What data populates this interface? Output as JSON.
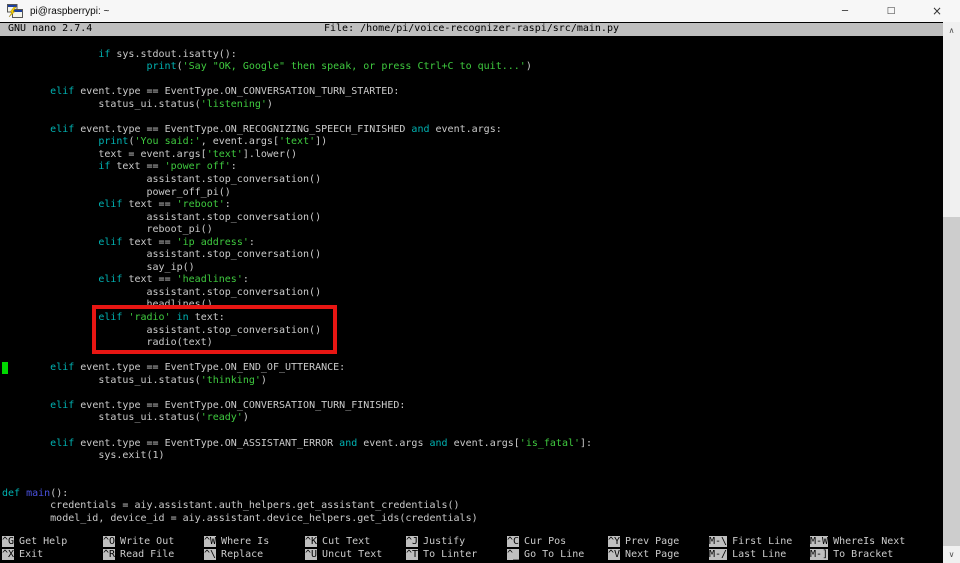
{
  "window": {
    "title": "pi@raspberrypi: ~",
    "controls": {
      "minimize": "─",
      "maximize": "□",
      "close": "×"
    }
  },
  "colors": {
    "c-plain": "#cbcbcb",
    "c-keyword": "#00b2b2",
    "c-string": "#3fca3f",
    "c-func": "#4a52e0",
    "c-cursor": "#00d900",
    "c-red": "#e81613",
    "c-bar": "#bfbfbf"
  },
  "nano": {
    "version": "GNU nano 2.7.4",
    "file": "File: /home/pi/voice-recognizer-raspi/src/main.py"
  },
  "editor": {
    "cursor": {
      "line": 26,
      "col": 0
    },
    "highlight": {
      "from_line": 22,
      "to_line": 24
    },
    "lines": [
      [],
      [
        [
          "p",
          "                "
        ],
        [
          "k",
          "if"
        ],
        [
          "p",
          " sys.stdout.isatty():"
        ]
      ],
      [
        [
          "p",
          "                        "
        ],
        [
          "k",
          "print"
        ],
        [
          "p",
          "("
        ],
        [
          "s",
          "'Say \"OK, Google\" then speak, or press Ctrl+C to quit...'"
        ],
        [
          "p",
          ")"
        ]
      ],
      [],
      [
        [
          "p",
          "        "
        ],
        [
          "k",
          "elif"
        ],
        [
          "p",
          " event.type == EventType.ON_CONVERSATION_TURN_STARTED:"
        ]
      ],
      [
        [
          "p",
          "                status_ui.status("
        ],
        [
          "s",
          "'listening'"
        ],
        [
          "p",
          ")"
        ]
      ],
      [],
      [
        [
          "p",
          "        "
        ],
        [
          "k",
          "elif"
        ],
        [
          "p",
          " event.type == EventType.ON_RECOGNIZING_SPEECH_FINISHED "
        ],
        [
          "k",
          "and"
        ],
        [
          "p",
          " event.args:"
        ]
      ],
      [
        [
          "p",
          "                "
        ],
        [
          "k",
          "print"
        ],
        [
          "p",
          "("
        ],
        [
          "s",
          "'You said:'"
        ],
        [
          "p",
          ", event.args["
        ],
        [
          "s",
          "'text'"
        ],
        [
          "p",
          "])"
        ]
      ],
      [
        [
          "p",
          "                text = event.args["
        ],
        [
          "s",
          "'text'"
        ],
        [
          "p",
          "].lower()"
        ]
      ],
      [
        [
          "p",
          "                "
        ],
        [
          "k",
          "if"
        ],
        [
          "p",
          " text == "
        ],
        [
          "s",
          "'power off'"
        ],
        [
          "p",
          ":"
        ]
      ],
      [
        [
          "p",
          "                        assistant.stop_conversation()"
        ]
      ],
      [
        [
          "p",
          "                        power_off_pi()"
        ]
      ],
      [
        [
          "p",
          "                "
        ],
        [
          "k",
          "elif"
        ],
        [
          "p",
          " text == "
        ],
        [
          "s",
          "'reboot'"
        ],
        [
          "p",
          ":"
        ]
      ],
      [
        [
          "p",
          "                        assistant.stop_conversation()"
        ]
      ],
      [
        [
          "p",
          "                        reboot_pi()"
        ]
      ],
      [
        [
          "p",
          "                "
        ],
        [
          "k",
          "elif"
        ],
        [
          "p",
          " text == "
        ],
        [
          "s",
          "'ip address'"
        ],
        [
          "p",
          ":"
        ]
      ],
      [
        [
          "p",
          "                        assistant.stop_conversation()"
        ]
      ],
      [
        [
          "p",
          "                        say_ip()"
        ]
      ],
      [
        [
          "p",
          "                "
        ],
        [
          "k",
          "elif"
        ],
        [
          "p",
          " text == "
        ],
        [
          "s",
          "'headlines'"
        ],
        [
          "p",
          ":"
        ]
      ],
      [
        [
          "p",
          "                        assistant.stop_conversation()"
        ]
      ],
      [
        [
          "p",
          "                        headlines()"
        ]
      ],
      [
        [
          "p",
          "                "
        ],
        [
          "k",
          "elif"
        ],
        [
          "p",
          " "
        ],
        [
          "s",
          "'radio'"
        ],
        [
          "p",
          " "
        ],
        [
          "k",
          "in"
        ],
        [
          "p",
          " text:"
        ]
      ],
      [
        [
          "p",
          "                        assistant.stop_conversation()"
        ]
      ],
      [
        [
          "p",
          "                        radio(text)"
        ]
      ],
      [],
      [
        [
          "p",
          "        "
        ],
        [
          "k",
          "elif"
        ],
        [
          "p",
          " event.type == EventType.ON_END_OF_UTTERANCE:"
        ]
      ],
      [
        [
          "p",
          "                status_ui.status("
        ],
        [
          "s",
          "'thinking'"
        ],
        [
          "p",
          ")"
        ]
      ],
      [],
      [
        [
          "p",
          "        "
        ],
        [
          "k",
          "elif"
        ],
        [
          "p",
          " event.type == EventType.ON_CONVERSATION_TURN_FINISHED:"
        ]
      ],
      [
        [
          "p",
          "                status_ui.status("
        ],
        [
          "s",
          "'ready'"
        ],
        [
          "p",
          ")"
        ]
      ],
      [],
      [
        [
          "p",
          "        "
        ],
        [
          "k",
          "elif"
        ],
        [
          "p",
          " event.type == EventType.ON_ASSISTANT_ERROR "
        ],
        [
          "k",
          "and"
        ],
        [
          "p",
          " event.args "
        ],
        [
          "k",
          "and"
        ],
        [
          "p",
          " event.args["
        ],
        [
          "s",
          "'is_fatal'"
        ],
        [
          "p",
          "]:"
        ]
      ],
      [
        [
          "p",
          "                sys.exit(1)"
        ]
      ],
      [],
      [],
      [
        [
          "k",
          "def"
        ],
        [
          "p",
          " "
        ],
        [
          "f",
          "main"
        ],
        [
          "p",
          "():"
        ]
      ],
      [
        [
          "p",
          "        credentials = aiy.assistant.auth_helpers.get_assistant_credentials()"
        ]
      ],
      [
        [
          "p",
          "        model_id, device_id = aiy.assistant.device_helpers.get_ids(credentials)"
        ]
      ]
    ]
  },
  "footer": {
    "rows": [
      [
        {
          "key": "^G",
          "label": "Get Help"
        },
        {
          "key": "^O",
          "label": "Write Out"
        },
        {
          "key": "^W",
          "label": "Where Is"
        },
        {
          "key": "^K",
          "label": "Cut Text"
        },
        {
          "key": "^J",
          "label": "Justify"
        },
        {
          "key": "^C",
          "label": "Cur Pos"
        },
        {
          "key": "^Y",
          "label": "Prev Page"
        },
        {
          "key": "M-\\",
          "label": "First Line"
        },
        {
          "key": "M-W",
          "label": "WhereIs Next"
        }
      ],
      [
        {
          "key": "^X",
          "label": "Exit"
        },
        {
          "key": "^R",
          "label": "Read File"
        },
        {
          "key": "^\\",
          "label": "Replace"
        },
        {
          "key": "^U",
          "label": "Uncut Text"
        },
        {
          "key": "^T",
          "label": "To Linter"
        },
        {
          "key": "^_",
          "label": "Go To Line"
        },
        {
          "key": "^V",
          "label": "Next Page"
        },
        {
          "key": "M-/",
          "label": "Last Line"
        },
        {
          "key": "M-]",
          "label": "To Bracket"
        }
      ]
    ]
  },
  "scrollbar": {
    "up": "∧",
    "down": "∨"
  }
}
